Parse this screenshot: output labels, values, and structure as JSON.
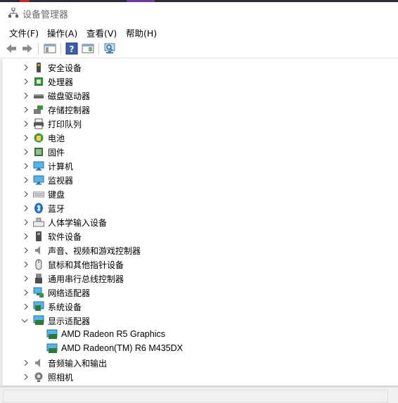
{
  "window": {
    "title": "设备管理器"
  },
  "menu": [
    "文件(F)",
    "操作(A)",
    "查看(V)",
    "帮助(H)"
  ],
  "toolbar": [
    "back-icon",
    "forward-icon",
    "show-hide-console-tree-icon",
    "help-icon",
    "properties-icon",
    "scan-hardware-icon"
  ],
  "tree": [
    {
      "label": "安全设备",
      "icon": "security-device-icon",
      "expanded": false
    },
    {
      "label": "处理器",
      "icon": "processor-icon",
      "expanded": false
    },
    {
      "label": "磁盘驱动器",
      "icon": "disk-drive-icon",
      "expanded": false
    },
    {
      "label": "存储控制器",
      "icon": "storage-controller-icon",
      "expanded": false
    },
    {
      "label": "打印队列",
      "icon": "printer-icon",
      "expanded": false
    },
    {
      "label": "电池",
      "icon": "battery-icon",
      "expanded": false
    },
    {
      "label": "固件",
      "icon": "firmware-icon",
      "expanded": false
    },
    {
      "label": "计算机",
      "icon": "computer-icon",
      "expanded": false
    },
    {
      "label": "监视器",
      "icon": "monitor-icon",
      "expanded": false
    },
    {
      "label": "键盘",
      "icon": "keyboard-icon",
      "expanded": false
    },
    {
      "label": "蓝牙",
      "icon": "bluetooth-icon",
      "expanded": false
    },
    {
      "label": "人体学输入设备",
      "icon": "hid-icon",
      "expanded": false
    },
    {
      "label": "软件设备",
      "icon": "software-device-icon",
      "expanded": false
    },
    {
      "label": "声音、视频和游戏控制器",
      "icon": "speaker-icon",
      "expanded": false
    },
    {
      "label": "鼠标和其他指针设备",
      "icon": "mouse-icon",
      "expanded": false
    },
    {
      "label": "通用串行总线控制器",
      "icon": "usb-icon",
      "expanded": false
    },
    {
      "label": "网络适配器",
      "icon": "network-adapter-icon",
      "expanded": false
    },
    {
      "label": "系统设备",
      "icon": "system-device-icon",
      "expanded": false
    },
    {
      "label": "显示适配器",
      "icon": "display-adapter-icon",
      "expanded": true,
      "children": [
        "AMD Radeon R5 Graphics",
        "AMD Radeon(TM) R6 M435DX"
      ]
    },
    {
      "label": "音频输入和输出",
      "icon": "audio-io-icon",
      "expanded": false
    },
    {
      "label": "照相机",
      "icon": "camera-icon",
      "expanded": false
    }
  ]
}
